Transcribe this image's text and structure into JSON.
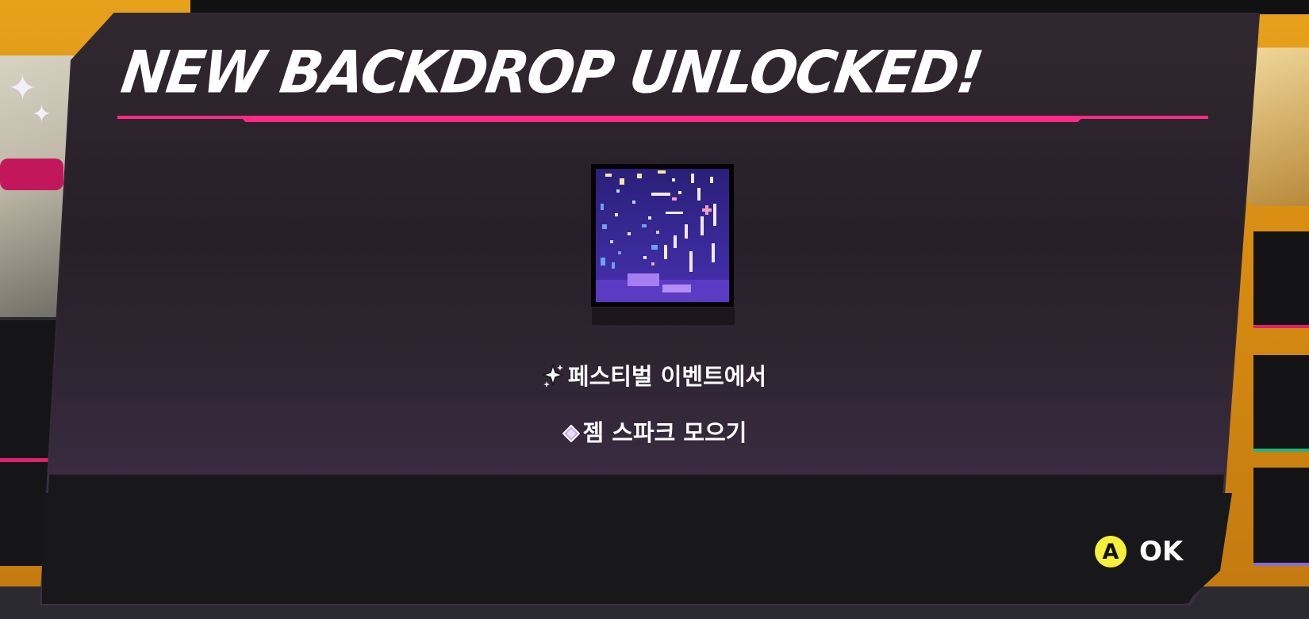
{
  "dialog": {
    "title": "NEW BACKDROP UNLOCKED!",
    "accent_color": "#ff2a86",
    "backdrop_icon": "starry-night-pixel-art-backdrop",
    "requirements": [
      {
        "icon": "sparkle-icon",
        "text": "페스티벌 이벤트에서"
      },
      {
        "icon": "gem-diamond-icon",
        "text": "젬 스파크 모으기"
      }
    ],
    "confirm": {
      "button_glyph": "A",
      "button_color": "#f5f03a",
      "label": "OK"
    }
  }
}
